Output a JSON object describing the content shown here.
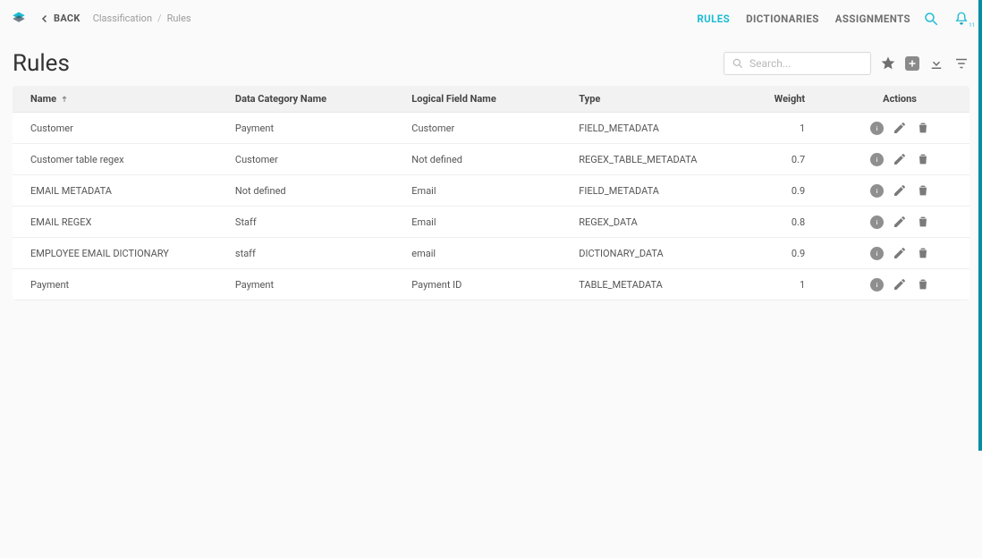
{
  "topbar": {
    "back_label": "BACK",
    "breadcrumb_parent": "Classification",
    "breadcrumb_current": "Rules",
    "tabs": {
      "rules": "RULES",
      "dictionaries": "DICTIONARIES",
      "assignments": "ASSIGNMENTS"
    }
  },
  "page": {
    "title": "Rules"
  },
  "search": {
    "placeholder": "Search..."
  },
  "table": {
    "headers": {
      "name": "Name",
      "category": "Data Category Name",
      "logical_field": "Logical Field Name",
      "type": "Type",
      "weight": "Weight",
      "actions": "Actions"
    },
    "rows": [
      {
        "name": "Customer",
        "category": "Payment",
        "logical_field": "Customer",
        "type": "FIELD_METADATA",
        "weight": "1"
      },
      {
        "name": "Customer table regex",
        "category": "Customer",
        "logical_field": "Not defined",
        "type": "REGEX_TABLE_METADATA",
        "weight": "0.7"
      },
      {
        "name": "EMAIL METADATA",
        "category": "Not defined",
        "logical_field": "Email",
        "type": "FIELD_METADATA",
        "weight": "0.9"
      },
      {
        "name": "EMAIL REGEX",
        "category": "Staff",
        "logical_field": "Email",
        "type": "REGEX_DATA",
        "weight": "0.8"
      },
      {
        "name": "EMPLOYEE EMAIL DICTIONARY",
        "category": "staff",
        "logical_field": "email",
        "type": "DICTIONARY_DATA",
        "weight": "0.9"
      },
      {
        "name": "Payment",
        "category": "Payment",
        "logical_field": "Payment  ID",
        "type": "TABLE_METADATA",
        "weight": "1"
      }
    ]
  },
  "notifications": {
    "badge": "11"
  }
}
